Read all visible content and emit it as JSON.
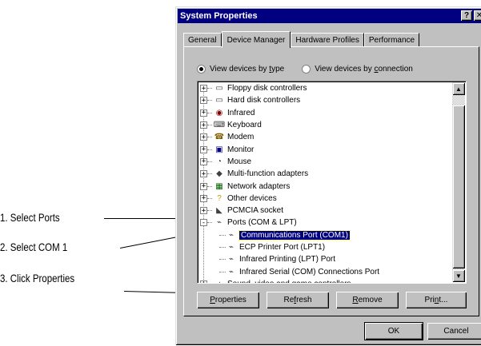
{
  "callouts": [
    "1. Select Ports",
    "2. Select COM 1",
    "3. Click Properties"
  ],
  "window": {
    "title": "System Properties",
    "help_button": "?",
    "close_button": "✕"
  },
  "tabs": [
    "General",
    "Device Manager",
    "Hardware Profiles",
    "Performance"
  ],
  "active_tab": "Device Manager",
  "view_options": {
    "by_type": "View devices by type",
    "by_connection": "View devices by connection",
    "selected": "by_type"
  },
  "tree": {
    "items": [
      {
        "label": "Floppy disk controllers",
        "icon": "floppy-controller-icon",
        "expander": "+"
      },
      {
        "label": "Hard disk controllers",
        "icon": "hdd-controller-icon",
        "expander": "+"
      },
      {
        "label": "Infrared",
        "icon": "infrared-icon",
        "expander": "+"
      },
      {
        "label": "Keyboard",
        "icon": "keyboard-icon",
        "expander": "+"
      },
      {
        "label": "Modem",
        "icon": "modem-icon",
        "expander": "+"
      },
      {
        "label": "Monitor",
        "icon": "monitor-icon",
        "expander": "+"
      },
      {
        "label": "Mouse",
        "icon": "mouse-icon",
        "expander": "+"
      },
      {
        "label": "Multi-function adapters",
        "icon": "multifunction-icon",
        "expander": "+"
      },
      {
        "label": "Network adapters",
        "icon": "network-adapter-icon",
        "expander": "+"
      },
      {
        "label": "Other devices",
        "icon": "question-icon",
        "expander": "+"
      },
      {
        "label": "PCMCIA socket",
        "icon": "pcmcia-icon",
        "expander": "+"
      },
      {
        "label": "Ports (COM & LPT)",
        "icon": "port-icon",
        "expander": "-"
      }
    ],
    "children": [
      {
        "label": "Communications Port (COM1)",
        "icon": "port-connector-icon",
        "selected": true
      },
      {
        "label": "ECP Printer Port (LPT1)",
        "icon": "port-connector-icon"
      },
      {
        "label": "Infrared Printing (LPT) Port",
        "icon": "port-connector-icon"
      },
      {
        "label": "Infrared Serial (COM) Connections Port",
        "icon": "port-connector-icon"
      }
    ],
    "partial_item": {
      "label": "Sound, video and game controllers",
      "icon": "sound-icon",
      "expander": "+"
    }
  },
  "buttons": {
    "properties": "Properties",
    "refresh": "Refresh",
    "remove": "Remove",
    "print": "Print...",
    "ok": "OK",
    "cancel": "Cancel"
  },
  "colors": {
    "titlebar": "#000080",
    "face": "#c0c0c0",
    "selection": "#000080"
  }
}
